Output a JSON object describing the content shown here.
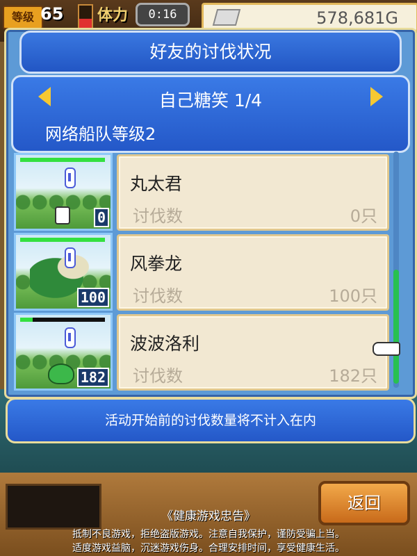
{
  "hud": {
    "level_label": "等级",
    "level": "65",
    "stamina_label": "体力",
    "stamina_fraction": 0.45,
    "timer": "0:16",
    "gold": "578,681G"
  },
  "dialog": {
    "title": "好友的讨伐状况",
    "player": "自己糖笑 1/4",
    "fleet_level": "网络船队等级2",
    "notice": "活动开始前的讨伐数量将不计入在内"
  },
  "monsters": [
    {
      "name": "丸太君",
      "kill_label": "讨伐数",
      "kills": "0只",
      "badge": "0",
      "hp": 1.0
    },
    {
      "name": "风拳龙",
      "kill_label": "讨伐数",
      "kills": "100只",
      "badge": "100",
      "hp": 1.0
    },
    {
      "name": "波波洛利",
      "kill_label": "讨伐数",
      "kills": "182只",
      "badge": "182",
      "hp": 0.15
    }
  ],
  "footer": {
    "back_label": "返回",
    "health_title": "《健康游戏忠告》",
    "health_line1": "抵制不良游戏，拒绝盗版游戏。注意自我保护，谨防受骗上当。",
    "health_line2": "适度游戏益脑，沉迷游戏伤身。合理安排时间，享受健康生活。"
  },
  "colors": {
    "panel_blue": "#2458c8",
    "accent_gold": "#f6c832",
    "hp_green": "#34e040"
  }
}
